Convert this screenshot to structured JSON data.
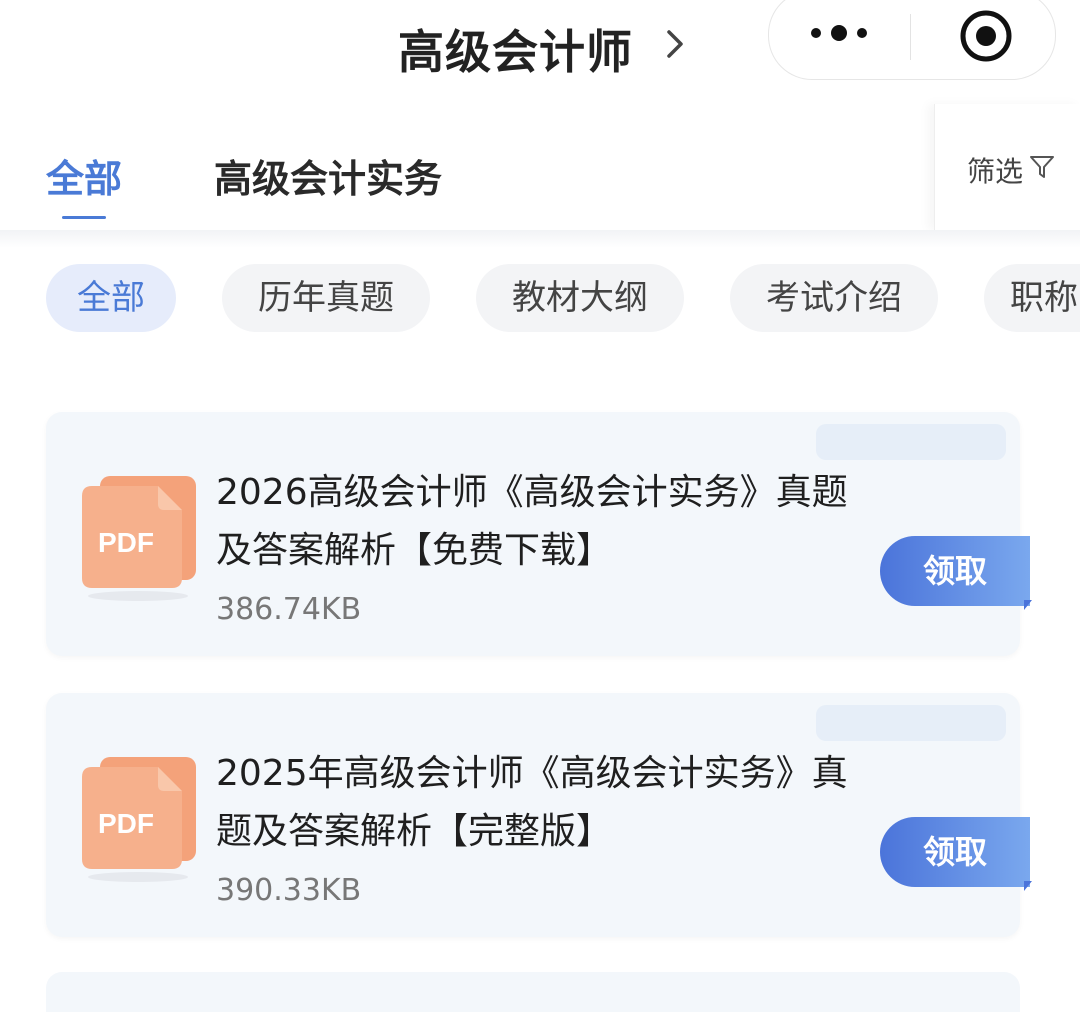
{
  "header": {
    "title": "高级会计师"
  },
  "tabs": [
    {
      "label": "全部",
      "active": true
    },
    {
      "label": "高级会计实务",
      "active": false
    }
  ],
  "filter": {
    "label": "筛选"
  },
  "chips": [
    {
      "label": "全部",
      "active": true
    },
    {
      "label": "历年真题",
      "active": false
    },
    {
      "label": "教材大纲",
      "active": false
    },
    {
      "label": "考试介绍",
      "active": false
    },
    {
      "label": "职称",
      "active": false
    }
  ],
  "documents": [
    {
      "title": "2026高级会计师《高级会计实务》真题及答案解析【免费下载】",
      "size": "386.74KB",
      "icon_label": "PDF",
      "button_label": "领取"
    },
    {
      "title": "2025年高级会计师《高级会计实务》真题及答案解析【完整版】",
      "size": "390.33KB",
      "icon_label": "PDF",
      "button_label": "领取"
    }
  ],
  "colors": {
    "accent": "#4a7ad6",
    "card_bg": "#f3f7fb",
    "pdf_orange": "#f39a6b"
  }
}
